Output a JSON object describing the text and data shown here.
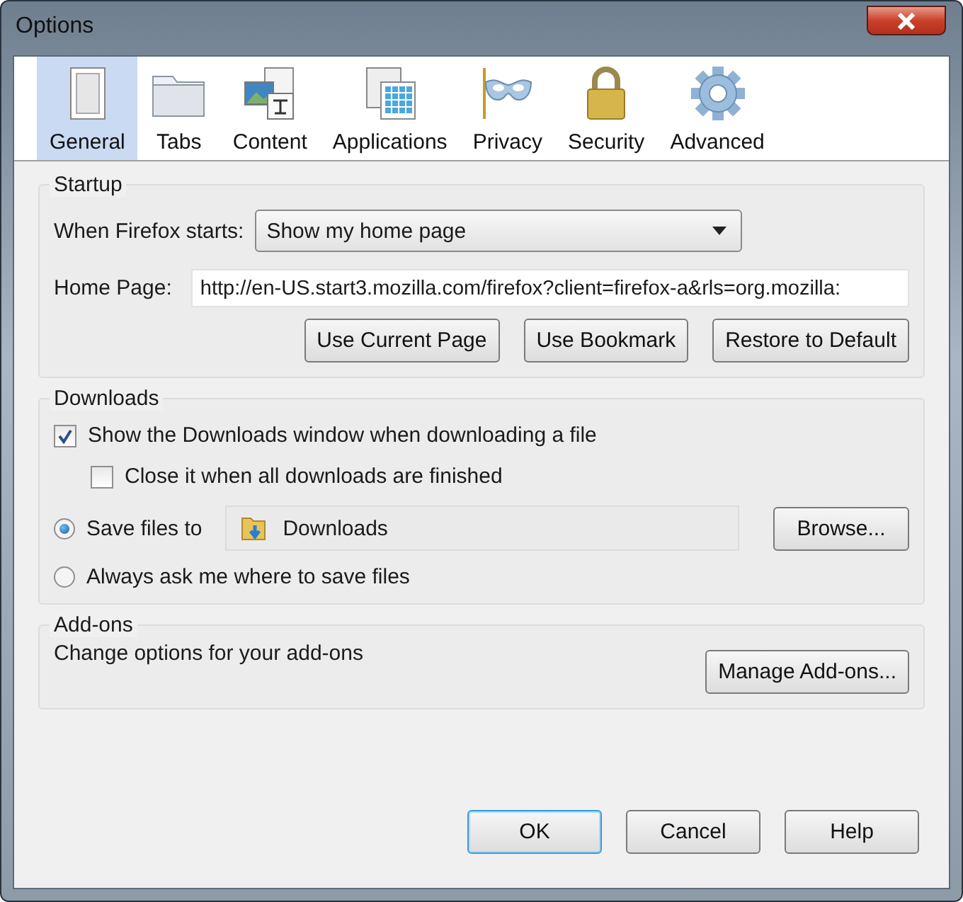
{
  "window": {
    "title": "Options"
  },
  "tabs": [
    {
      "label": "General",
      "kind": "general",
      "selected": true
    },
    {
      "label": "Tabs",
      "kind": "tabs",
      "selected": false
    },
    {
      "label": "Content",
      "kind": "content",
      "selected": false
    },
    {
      "label": "Applications",
      "kind": "applications",
      "selected": false
    },
    {
      "label": "Privacy",
      "kind": "privacy",
      "selected": false
    },
    {
      "label": "Security",
      "kind": "security",
      "selected": false
    },
    {
      "label": "Advanced",
      "kind": "advanced",
      "selected": false
    }
  ],
  "startup": {
    "legend": "Startup",
    "when_label": "When Firefox starts:",
    "when_value": "Show my home page",
    "home_label": "Home Page:",
    "home_value": "http://en-US.start3.mozilla.com/firefox?client=firefox-a&rls=org.mozilla:",
    "buttons": [
      "Use Current Page",
      "Use Bookmark",
      "Restore to Default"
    ]
  },
  "downloads": {
    "legend": "Downloads",
    "checkboxes": [
      {
        "label": "Show the Downloads window when downloading a file",
        "checked": true,
        "children": [
          {
            "label": "Close it when all downloads are finished",
            "checked": false
          }
        ]
      }
    ],
    "radios": [
      {
        "label": "Save files to",
        "selected": true,
        "folder": "Downloads"
      },
      {
        "label": "Always ask me where to save files",
        "selected": false
      }
    ],
    "browse_button": "Browse..."
  },
  "addons": {
    "legend": "Add-ons",
    "text": "Change options for your add-ons",
    "button": "Manage Add-ons..."
  },
  "buttons": [
    {
      "label": "OK",
      "default": true
    },
    {
      "label": "Cancel",
      "default": false
    },
    {
      "label": "Help",
      "default": false
    }
  ]
}
